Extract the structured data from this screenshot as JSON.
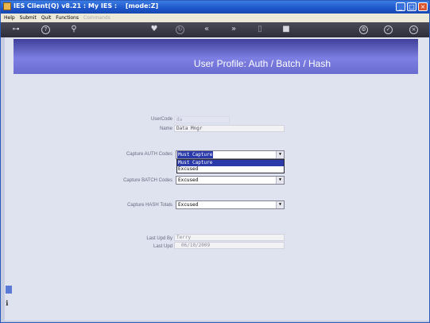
{
  "window": {
    "title": "IES Client(Q) v8.21 : My IES :",
    "mode": "[mode:Z]"
  },
  "menu": {
    "items": [
      "Help",
      "Submit",
      "Quit",
      "Functions"
    ],
    "disabled_item": "Commands"
  },
  "toolbar": {
    "icons": [
      "key-icon",
      "help-icon",
      "search-icon",
      "heart-icon",
      "refresh-icon",
      "back-icon",
      "forward-icon",
      "document-icon",
      "stop-icon",
      "gear-icon",
      "check-icon",
      "close-icon"
    ]
  },
  "header": {
    "title": "User Profile: Auth / Batch / Hash"
  },
  "form": {
    "usercode_label": "UserCode",
    "usercode_value": "da",
    "name_label": "Name",
    "name_value": "Data Mngr",
    "auth_label": "Capture AUTH Codes",
    "auth_value": "Must Capture",
    "auth_options": [
      "Must Capture",
      "Excused"
    ],
    "batch_label": "Capture BATCH Codes",
    "batch_value": "Excused",
    "hash_label": "Capture HASH Totals",
    "hash_value": "Excused",
    "lastupdby_label": "Last Upd By",
    "lastupdby_value": "Terry",
    "lastupd_label": "Last Upd",
    "lastupd_value": "06/10/2009"
  },
  "colors": {
    "header_band": "#7d80e2",
    "title_bar": "#1d55c9",
    "selection": "#2a3aa8"
  }
}
